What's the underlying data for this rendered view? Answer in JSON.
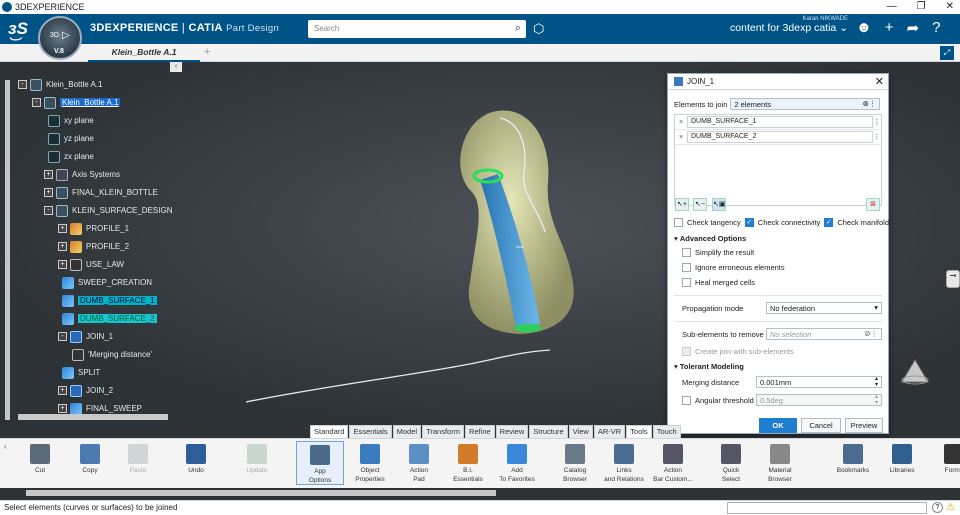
{
  "window": {
    "title": "3DEXPERIENCE",
    "controls": [
      "—",
      "❐",
      "✕"
    ]
  },
  "header": {
    "brand_bold": "3DEXPERIENCE",
    "brand_sep": " | ",
    "brand_app": "CATIA",
    "brand_module": "Part Design",
    "compass_version": "V.8",
    "compass_label": "3D",
    "search_placeholder": "Search",
    "user_name": "Karan NIKWADE",
    "context": "content for 3dexp catia",
    "accent": "#005386"
  },
  "tabs": {
    "document": "Klein_Bottle A.1",
    "add": "+"
  },
  "tree": {
    "collapse": "‹",
    "nodes": [
      {
        "label": "Klein_Bottle A.1",
        "style": ""
      },
      {
        "label": "Klein_Bottle A.1",
        "style": "blue"
      },
      {
        "label": "xy plane",
        "style": ""
      },
      {
        "label": "yz plane",
        "style": ""
      },
      {
        "label": "zx plane",
        "style": ""
      },
      {
        "label": "Axis Systems",
        "style": ""
      },
      {
        "label": "FINAL_KLEIN_BOTTLE",
        "style": ""
      },
      {
        "label": "KLEIN_SURFACE_DESIGN",
        "style": ""
      },
      {
        "label": "PROFILE_1",
        "style": ""
      },
      {
        "label": "PROFILE_2",
        "style": ""
      },
      {
        "label": "USE_LAW",
        "style": ""
      },
      {
        "label": "SWEEP_CREATION",
        "style": ""
      },
      {
        "label": "DUMB_SURFACE_1",
        "style": "sel"
      },
      {
        "label": "DUMB_SURFACE_2",
        "style": "sel2"
      },
      {
        "label": "JOIN_1",
        "style": ""
      },
      {
        "label": "'Merging distance'",
        "style": ""
      },
      {
        "label": "SPLIT",
        "style": ""
      },
      {
        "label": "JOIN_2",
        "style": ""
      },
      {
        "label": "FINAL_SWEEP",
        "style": ""
      }
    ]
  },
  "dialog": {
    "title": "JOIN_1",
    "close": "✕",
    "elements_label": "Elements to join",
    "elements_value": "2 elements",
    "items": [
      "DUMB_SURFACE_1",
      "DUMB_SURFACE_2"
    ],
    "check_tangency": "Check tangency",
    "check_connectivity": "Check connectivity",
    "check_manifold": "Check manifold",
    "advanced": "Advanced Options",
    "simplify": "Simplify the result",
    "ignore": "Ignore erroneous elements",
    "heal": "Heal merged cells",
    "propagation_label": "Propagation mode",
    "propagation_value": "No federation",
    "sub_label": "Sub-elements to remove",
    "sub_placeholder": "No selection",
    "create_join": "Create join with sub-elements",
    "tolerant": "Tolerant Modeling",
    "merging_label": "Merging distance",
    "merging_value": "0.001mm",
    "angular_label": "Angular threshold",
    "angular_value": "0.5deg",
    "ok": "OK",
    "cancel": "Cancel",
    "preview": "Preview"
  },
  "toolbar_tabs": [
    "Standard",
    "Essentials",
    "Model",
    "Transform",
    "Refine",
    "Review",
    "Structure",
    "View",
    "AR-VR",
    "Tools",
    "Touch"
  ],
  "toolbar": [
    {
      "label": "Cut",
      "icon": "scissors-icon",
      "state": ""
    },
    {
      "label": "Copy",
      "icon": "copy-icon",
      "state": ""
    },
    {
      "label": "Paste",
      "icon": "paste-icon",
      "state": "disabled"
    },
    {
      "label": "Undo",
      "icon": "undo-icon",
      "state": ""
    },
    {
      "label": "Update",
      "icon": "update-icon",
      "state": "disabled"
    },
    {
      "label": "App\nOptions",
      "icon": "app-options-icon",
      "state": "active"
    },
    {
      "label": "Object\nProperties",
      "icon": "properties-icon",
      "state": ""
    },
    {
      "label": "Action\nPad",
      "icon": "action-pad-icon",
      "state": ""
    },
    {
      "label": "B.I.\nEssentials",
      "icon": "bi-essentials-icon",
      "state": ""
    },
    {
      "label": "Add\nTo Favorites",
      "icon": "star-icon",
      "state": ""
    },
    {
      "label": "Catalog\nBrowser",
      "icon": "catalog-icon",
      "state": ""
    },
    {
      "label": "Links\nand Relations",
      "icon": "links-icon",
      "state": ""
    },
    {
      "label": "Action\nBar Custom...",
      "icon": "customize-icon",
      "state": ""
    },
    {
      "label": "Quick\nSelect",
      "icon": "quick-select-icon",
      "state": ""
    },
    {
      "label": "Material\nBrowser",
      "icon": "material-icon",
      "state": ""
    },
    {
      "label": "Bookmarks",
      "icon": "bookmarks-icon",
      "state": ""
    },
    {
      "label": "Libraries",
      "icon": "libraries-icon",
      "state": ""
    },
    {
      "label": "Formu",
      "icon": "formula-icon",
      "state": ""
    }
  ],
  "status": {
    "message": "Select elements (curves or surfaces) to be joined",
    "help": "?"
  }
}
